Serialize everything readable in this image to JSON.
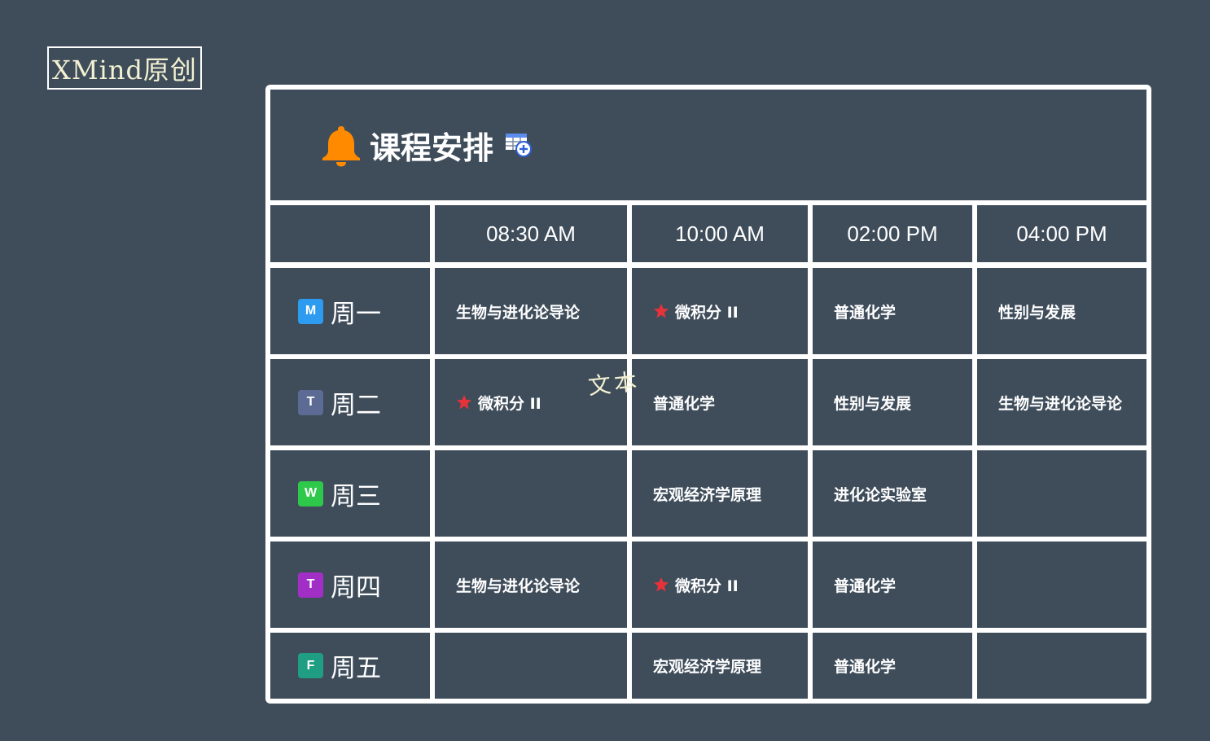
{
  "watermark": {
    "text": "XMind原创"
  },
  "header": {
    "title": "课程安排",
    "icon": "bell-icon",
    "action_icon": "table-add-icon",
    "icon_color": "#ff8a00"
  },
  "table": {
    "times": [
      "08:30 AM",
      "10:00 AM",
      "02:00 PM",
      "04:00 PM"
    ],
    "days": [
      {
        "badge": "M",
        "name": "周一",
        "color": "#2d9cf0"
      },
      {
        "badge": "T",
        "name": "周二",
        "color": "#5b6b93"
      },
      {
        "badge": "W",
        "name": "周三",
        "color": "#2ec84b"
      },
      {
        "badge": "T",
        "name": "周四",
        "color": "#a12fc6"
      },
      {
        "badge": "F",
        "name": "周五",
        "color": "#1f9e84"
      }
    ],
    "rows": [
      [
        {
          "text": "生物与进化论导论",
          "starred": false
        },
        {
          "text": "微积分 II",
          "starred": true
        },
        {
          "text": "普通化学",
          "starred": false
        },
        {
          "text": "性别与发展",
          "starred": false
        }
      ],
      [
        {
          "text": "微积分 II",
          "starred": true
        },
        {
          "text": "普通化学",
          "starred": false
        },
        {
          "text": "性别与发展",
          "starred": false
        },
        {
          "text": "生物与进化论导论",
          "starred": false
        }
      ],
      [
        {
          "text": "",
          "starred": false
        },
        {
          "text": "宏观经济学原理",
          "starred": false
        },
        {
          "text": "进化论实验室",
          "starred": false
        },
        {
          "text": "",
          "starred": false
        }
      ],
      [
        {
          "text": "生物与进化论导论",
          "starred": false
        },
        {
          "text": "微积分 II",
          "starred": true
        },
        {
          "text": "普通化学",
          "starred": false
        },
        {
          "text": "",
          "starred": false
        }
      ],
      [
        {
          "text": "",
          "starred": false
        },
        {
          "text": "宏观经济学原理",
          "starred": false
        },
        {
          "text": "普通化学",
          "starred": false
        },
        {
          "text": "",
          "starred": false
        }
      ]
    ],
    "star_color": "#e8323a"
  },
  "floating_label": {
    "text": "文本"
  }
}
